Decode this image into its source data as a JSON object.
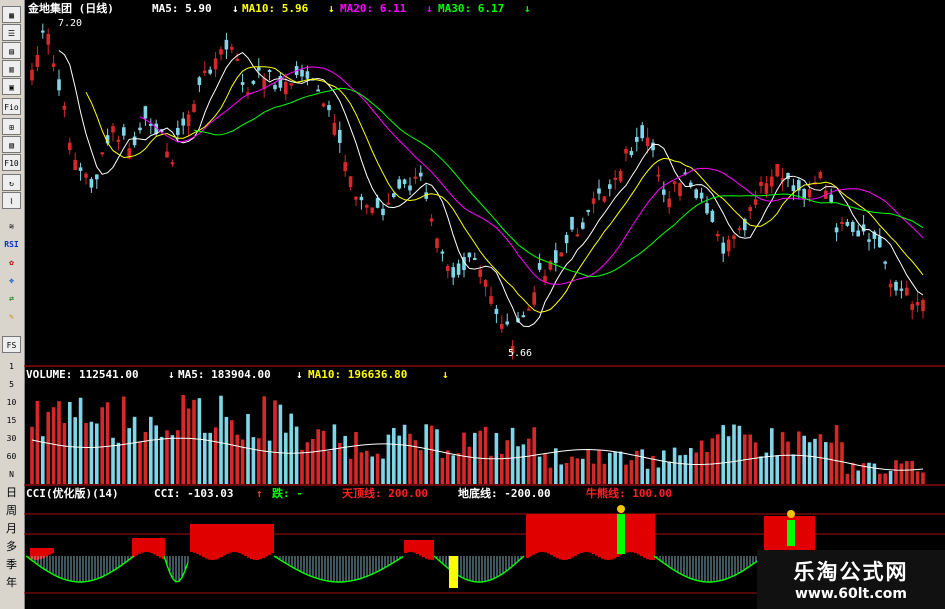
{
  "toolbar": {
    "icons": [
      "chart-icon",
      "list-icon",
      "bar-icon",
      "candle-icon",
      "chart-icon"
    ],
    "fio_label": "Fio",
    "icons2": [
      "grid-icon",
      "chart-icon"
    ],
    "f10_label": "F10",
    "icons3": [
      "refresh-icon",
      "line-icon"
    ],
    "rsi_label": "RSI",
    "icons4": [
      "flower-icon",
      "move-icon",
      "arrow-icon",
      "pencil-icon"
    ],
    "fs_label": "FS",
    "scale_labels": [
      "1",
      "5",
      "10",
      "15",
      "30",
      "60",
      "N"
    ],
    "period_labels": [
      "日",
      "周",
      "月",
      "多",
      "季",
      "年"
    ]
  },
  "price_header": {
    "title": "金地集团 (日线)",
    "ma5": "MA5: 5.90",
    "ma10": "MA10: 5.96",
    "ma20": "MA20: 6.11",
    "ma30": "MA30: 6.17",
    "arrow": "↓"
  },
  "price_high_label": "7.20",
  "price_low_label": "5.66",
  "volume_header": {
    "volume": "VOLUME: 112541.00",
    "ma5": "MA5: 183904.00",
    "ma10": "MA10: 196636.80",
    "arrow": "↓"
  },
  "cci_header": {
    "title": "CCI(优化版)(14)",
    "cci": "CCI: -103.03",
    "up_arrow": "↑",
    "fall": "跌: -",
    "top_line": "天顶线: 200.00",
    "bottom_line": "地底线: -200.00",
    "bull_line": "牛熊线: 100.00"
  },
  "watermark": {
    "name": "乐淘公式网",
    "url": "www.60lt.com"
  },
  "colors": {
    "up": "#d62828",
    "down": "#7fd6e8",
    "ma5": "#ffffff",
    "ma10": "#ffff00",
    "ma20": "#ff00ff",
    "ma30": "#00ff00",
    "cci_red": "#e00000",
    "cci_green": "#00ff00",
    "cci_yellow": "#ffff00",
    "separator": "#a01010",
    "header_white": "#ffffff"
  },
  "chart_data": {
    "type": "candlestick",
    "price_axis": {
      "min": 5.66,
      "max": 7.2
    },
    "candles": [],
    "volume": [],
    "cci": []
  }
}
